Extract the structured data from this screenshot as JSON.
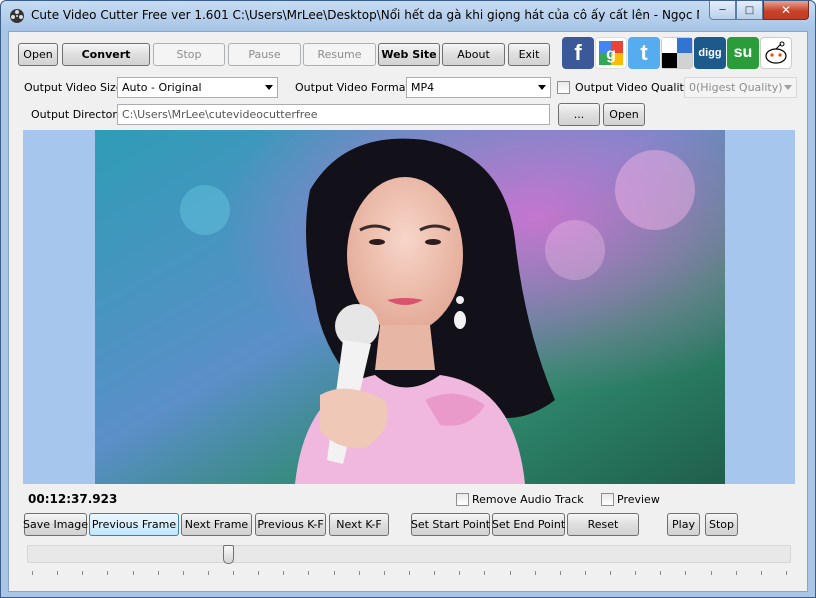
{
  "window": {
    "title": "Cute Video Cutter Free ver 1.601  C:\\Users\\MrLee\\Desktop\\Nổi hết da gà khi giọng hát của cô ấy cất lên - Ngọc Nữ Bolero P...",
    "minimize_glyph": "─",
    "maximize_glyph": "□",
    "close_glyph": "✕"
  },
  "toolbar": {
    "open": "Open",
    "convert": "Convert",
    "stop": "Stop",
    "pause": "Pause",
    "resume": "Resume",
    "website": "Web Site",
    "about": "About",
    "exit": "Exit"
  },
  "social": [
    {
      "name": "facebook-icon",
      "glyph": "f",
      "color": "#3b5998"
    },
    {
      "name": "google-icon",
      "glyph": "g",
      "color": "#dd4b39"
    },
    {
      "name": "twitter-icon",
      "glyph": "t",
      "color": "#55acee"
    },
    {
      "name": "delicious-icon",
      "glyph": "",
      "color": "#3274d1"
    },
    {
      "name": "digg-icon",
      "glyph": "digg",
      "color": "#1d5a8c"
    },
    {
      "name": "stumbleupon-icon",
      "glyph": "su",
      "color": "#2a9d3a"
    },
    {
      "name": "reddit-icon",
      "glyph": "",
      "color": "#ff4500"
    }
  ],
  "settings": {
    "output_video_size_label": "Output Video Size:",
    "output_video_size_value": "Auto - Original",
    "output_video_format_label": "Output Video Format:",
    "output_video_format_value": "MP4",
    "output_video_quality_label": "Output Video Quality",
    "output_video_quality_value": "0(Higest Quality)",
    "output_directory_label": "Output Directory:",
    "output_directory_value": "C:\\Users\\MrLee\\cutevideocutterfree",
    "browse_label": "...",
    "open_dir_label": "Open"
  },
  "playback": {
    "timecode": "00:12:37.923",
    "remove_audio_label": "Remove Audio Track",
    "preview_label": "Preview",
    "save_image": "Save Image",
    "previous_frame": "Previous Frame",
    "next_frame": "Next Frame",
    "previous_kf": "Previous K-F",
    "next_kf": "Next K-F",
    "set_start": "Set  Start Point",
    "set_end": "Set  End Point",
    "reset": "Reset",
    "play": "Play",
    "stop": "Stop",
    "slider_position_fraction": 0.26
  },
  "colors": {
    "video_background": "#a7c6ed",
    "title_bar": "#b9d1ec"
  }
}
